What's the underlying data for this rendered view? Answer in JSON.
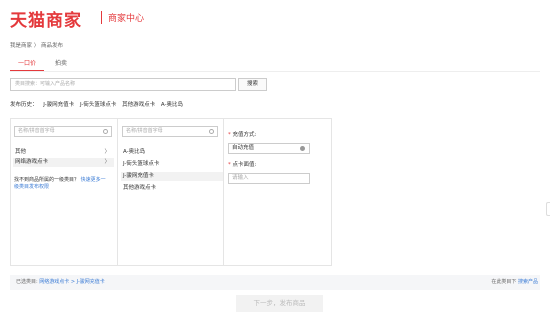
{
  "header": {
    "logo": "天猫商家",
    "subtitle": "商家中心"
  },
  "breadcrumb": {
    "home": "我是商家",
    "sep": "〉",
    "current": "商品发布"
  },
  "tabs": [
    {
      "label": "一口价"
    },
    {
      "label": "拍卖"
    }
  ],
  "search": {
    "placeholder": "类目搜索：可输入产品名称",
    "button": "搜索"
  },
  "history": {
    "label": "发布历史：",
    "items": [
      "J-骏网充值卡",
      "J-街头篮球点卡",
      "其他游戏点卡",
      "A-奥比岛"
    ]
  },
  "col1": {
    "filter_placeholder": "名称/拼音首字母",
    "items": [
      {
        "label": "其他",
        "chev": "〉"
      },
      {
        "label": "网络游戏点卡",
        "chev": "〉"
      }
    ],
    "hint_text": "找不到商品所属的一级类目？",
    "hint_link": "快速更多一级类目发布权限"
  },
  "col2": {
    "filter_placeholder": "名称/拼音首字母",
    "items": [
      "A-奥比岛",
      "J-街头篮球点卡",
      "J-骏网充值卡",
      "其他游戏点卡"
    ]
  },
  "fields": {
    "recharge_label": "充值方式:",
    "recharge_value": "自动充值",
    "face_label": "点卡面值:",
    "face_placeholder": "请输入"
  },
  "footer": {
    "selected_label": "已选类目:",
    "selected_path": "网络游戏点卡 > J-骏网充值卡",
    "right_text": "在此类目下",
    "right_link": "搜索产品",
    "next_button": "下一步，发布商品"
  },
  "colors": {
    "accent": "#e4393c",
    "link": "#3a7bd5"
  }
}
